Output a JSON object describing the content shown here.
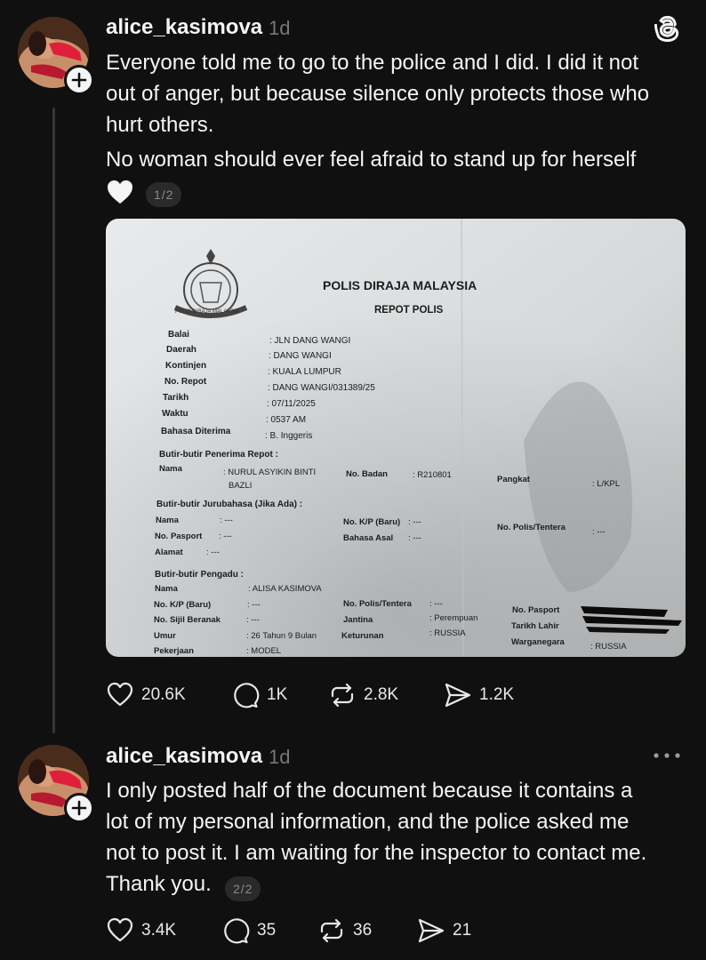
{
  "app": {
    "logo_icon": "threads-logo-icon"
  },
  "posts": [
    {
      "username": "alice_kasimova",
      "time": "1d",
      "lines": [
        "Everyone told me to go to the police and I did. I did it not",
        "out of anger, but because silence only protects those who",
        "hurt others."
      ],
      "second_paragraph": "No woman should ever feel afraid to stand up for herself",
      "emoji": "white-heart-icon",
      "pager": "1/2",
      "actions": {
        "likes": "20.6K",
        "replies": "1K",
        "reposts": "2.8K",
        "shares": "1.2K"
      }
    },
    {
      "username": "alice_kasimova",
      "time": "1d",
      "lines": [
        "I only posted half of the document because it contains a",
        "lot of my personal information, and the police asked me",
        "not to post it. I am waiting for the inspector to contact me.",
        "Thank you."
      ],
      "pager": "2/2",
      "actions": {
        "likes": "3.4K",
        "replies": "35",
        "reposts": "36",
        "shares": "21"
      }
    }
  ],
  "document": {
    "header": "POLIS DIRAJA MALAYSIA",
    "subheader": "REPOT POLIS",
    "badge_text": "POLIS DIRAJA MALAYSIA",
    "fields": [
      {
        "label": "Balai",
        "value": ": JLN DANG WANGI"
      },
      {
        "label": "Daerah",
        "value": ": DANG WANGI"
      },
      {
        "label": "Kontinjen",
        "value": ": KUALA LUMPUR"
      },
      {
        "label": "No. Repot",
        "value": ": DANG WANGI/031389/25"
      },
      {
        "label": "Tarikh",
        "value": ": 07/11/2025"
      },
      {
        "label": "Waktu",
        "value": ": 0537 AM"
      },
      {
        "label": "Bahasa Diterima",
        "value": ": B. Inggeris"
      }
    ],
    "receiver_section": "Butir-butir Penerima Repot :",
    "receiver": {
      "nama_label": "Nama",
      "nama_value": ": NURUL ASYIKIN BINTI",
      "nama_value2": "BAZLI",
      "badan_label": "No. Badan",
      "badan_value": ": R210801",
      "pangkat_label": "Pangkat",
      "pangkat_value": ": L/KPL"
    },
    "interpreter_section": "Butir-butir Jurubahasa (Jika Ada) :",
    "interpreter": {
      "nama_label": "Nama",
      "nama_value": ": ---",
      "paspot_label": "No. Pasport",
      "paspot_value": ": ---",
      "alamat_label": "Alamat",
      "alamat_value": ": ---",
      "kp_label": "No. K/P (Baru)",
      "kp_value": ": ---",
      "bahasa_label": "Bahasa Asal",
      "bahasa_value": ": ---",
      "polis_label": "No. Polis/Tentera",
      "polis_value": ": ---"
    },
    "complainant_section": "Butir-butir Pengadu :",
    "complainant": {
      "nama_label": "Nama",
      "nama_value": ": ALISA KASIMOVA",
      "kp_label": "No. K/P (Baru)",
      "kp_value": ": ---",
      "sijil_label": "No. Sijil Beranak",
      "sijil_value": ": ---",
      "umur_label": "Umur",
      "umur_value": ": 26 Tahun 9 Bulan",
      "pekerjaan_label": "Pekerjaan",
      "pekerjaan_value": ": MODEL",
      "polis_label": "No. Polis/Tentera",
      "polis_value": ": ---",
      "jantina_label": "Jantina",
      "jantina_value": ": Perempuan",
      "keturunan_label": "Keturunan",
      "keturunan_value": ": RUSSIA",
      "paspot_label": "No. Pasport",
      "lahir_label": "Tarikh Lahir",
      "warga_label": "Warganegara",
      "warga_value": ": RUSSIA"
    }
  }
}
